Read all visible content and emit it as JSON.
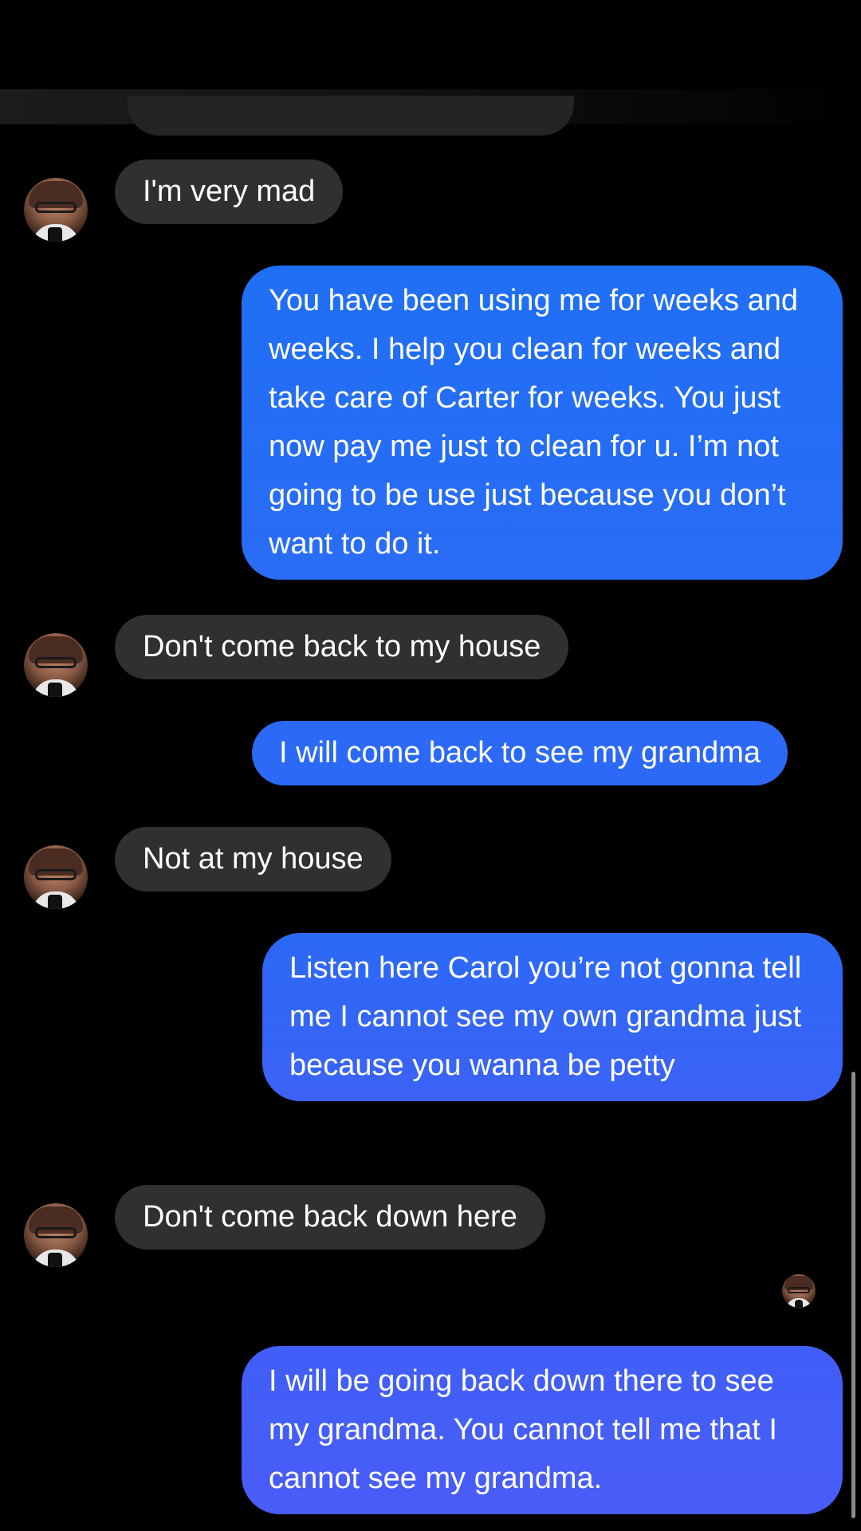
{
  "conversation": {
    "messages": [
      {
        "direction": "incoming",
        "text": "I'm very mad"
      },
      {
        "direction": "outgoing",
        "text": "You have been using me for weeks and weeks. I help you clean for weeks and take care of Carter for weeks. You just now pay me just to clean for u. I’m not going to be use just because you don’t want to do it."
      },
      {
        "direction": "incoming",
        "text": "Don't come back to my house"
      },
      {
        "direction": "outgoing",
        "text": "I will come back to see my grandma"
      },
      {
        "direction": "incoming",
        "text": "Not at my house"
      },
      {
        "direction": "outgoing",
        "text": "Listen here Carol you’re not gonna tell me I cannot see my own grandma just because you wanna be petty"
      },
      {
        "direction": "incoming",
        "text": "Don't come back down here"
      },
      {
        "direction": "outgoing",
        "text": "I will be going back down there to see my grandma. You cannot tell me that I cannot see my grandma."
      }
    ]
  },
  "colors": {
    "background": "#000000",
    "incoming_bubble": "#303033",
    "outgoing_gradient_top": "#1f6ff5",
    "outgoing_gradient_bottom": "#4a5cf8",
    "text": "#ffffff"
  },
  "icons": {
    "contact_avatar": "contact-avatar-icon",
    "seen_avatar": "read-receipt-avatar-icon"
  }
}
